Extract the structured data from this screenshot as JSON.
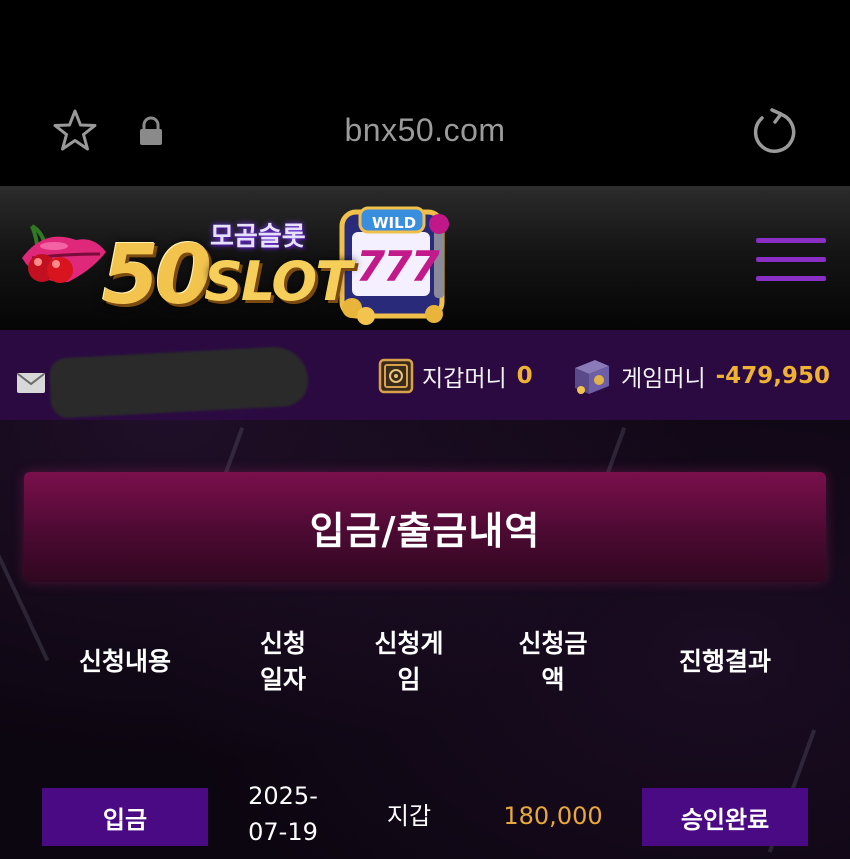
{
  "browser": {
    "url": "bnx50.com"
  },
  "header": {
    "logo_korean": "모곰슬롯",
    "logo_number": "50",
    "logo_word": "SLOT",
    "reel_text": "WILD",
    "reel_digits": "777"
  },
  "info": {
    "wallet_label": "지갑머니",
    "wallet_value": "0",
    "game_label": "게임머니",
    "game_value": "-479,950"
  },
  "page": {
    "title": "입금/출금내역"
  },
  "table": {
    "headers": [
      {
        "line1": "신청내용",
        "line2": ""
      },
      {
        "line1": "신청",
        "line2": "일자"
      },
      {
        "line1": "신청게",
        "line2": "임"
      },
      {
        "line1": "신청금",
        "line2": "액"
      },
      {
        "line1": "진행결과",
        "line2": ""
      }
    ],
    "rows": [
      {
        "type": "입금",
        "date_line1": "2025-",
        "date_line2": "07-19",
        "game": "지갑",
        "amount": "180,000",
        "status": "승인완료"
      }
    ]
  },
  "colors": {
    "accent_purple": "#4a0a84",
    "menu_purple": "#8a2fc6",
    "banner_magenta": "#7a0f4c",
    "money_gold": "#f0b232"
  }
}
